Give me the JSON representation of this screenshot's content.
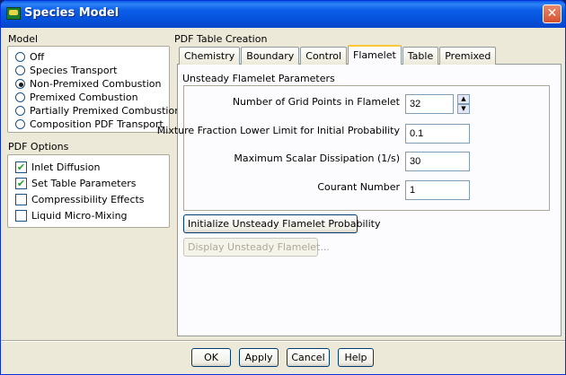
{
  "window": {
    "title": "Species Model",
    "close_glyph": "✕"
  },
  "model": {
    "label": "Model",
    "options": [
      {
        "label": "Off",
        "selected": false
      },
      {
        "label": "Species Transport",
        "selected": false
      },
      {
        "label": "Non-Premixed Combustion",
        "selected": true
      },
      {
        "label": "Premixed Combustion",
        "selected": false
      },
      {
        "label": "Partially Premixed Combustion",
        "selected": false
      },
      {
        "label": "Composition PDF Transport",
        "selected": false
      }
    ]
  },
  "pdf_options": {
    "label": "PDF Options",
    "items": [
      {
        "label": "Inlet Diffusion",
        "checked": true
      },
      {
        "label": "Set Table Parameters",
        "checked": true
      },
      {
        "label": "Compressibility Effects",
        "checked": false
      },
      {
        "label": "Liquid Micro-Mixing",
        "checked": false
      }
    ]
  },
  "pdf_table": {
    "label": "PDF Table Creation",
    "tabs": [
      "Chemistry",
      "Boundary",
      "Control",
      "Flamelet",
      "Table",
      "Premixed"
    ],
    "active_tab": "Flamelet"
  },
  "flamelet": {
    "section_title": "Unsteady Flamelet Parameters",
    "params": [
      {
        "label": "Number of Grid Points in Flamelet",
        "value": "32"
      },
      {
        "label": "Mixture Fraction Lower Limit for Initial Probability",
        "value": "0.1"
      },
      {
        "label": "Maximum Scalar Dissipation (1/s)",
        "value": "30"
      },
      {
        "label": "Courant Number",
        "value": "1"
      }
    ],
    "init_button": "Initialize Unsteady Flamelet Probability",
    "display_button": "Display Unsteady Flamelet..."
  },
  "footer": {
    "ok": "OK",
    "apply": "Apply",
    "cancel": "Cancel",
    "help": "Help"
  },
  "check_glyph": "✔",
  "spin_up": "▲",
  "spin_down": "▼"
}
